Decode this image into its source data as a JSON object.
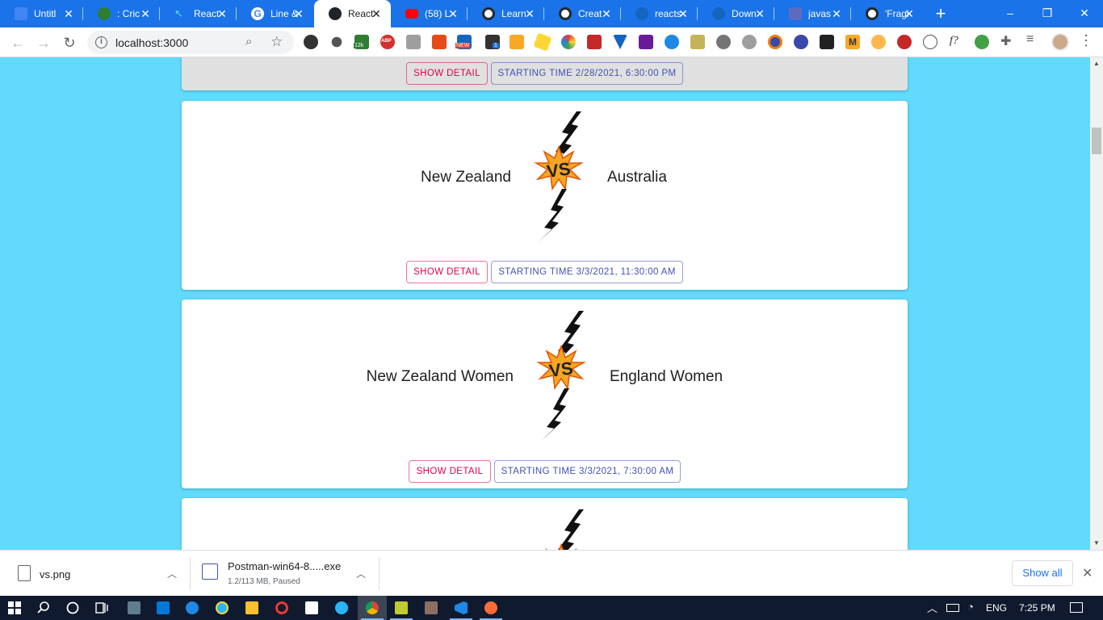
{
  "browser": {
    "tabs": [
      {
        "title": "Untitl",
        "favicon_color": "#4285f4",
        "active": false
      },
      {
        "title": ": Cric",
        "favicon_color": "#2e7d32",
        "active": false
      },
      {
        "title": "React",
        "favicon_color": "#61dafb",
        "active": false
      },
      {
        "title": "Line &",
        "favicon_color": "#ffffff",
        "active": false
      },
      {
        "title": "React",
        "favicon_color": "#20232a",
        "active": true
      },
      {
        "title": "(58) L",
        "favicon_color": "#ff0000",
        "active": false
      },
      {
        "title": "Learn",
        "favicon_color": "#24292e",
        "active": false
      },
      {
        "title": "Creat",
        "favicon_color": "#24292e",
        "active": false
      },
      {
        "title": "reacts",
        "favicon_color": "#1565c0",
        "active": false
      },
      {
        "title": "Down",
        "favicon_color": "#1565c0",
        "active": false
      },
      {
        "title": "javas",
        "favicon_color": "#5c6bc0",
        "active": false
      },
      {
        "title": "'Fragi",
        "favicon_color": "#24292e",
        "active": false
      }
    ],
    "new_tab": "+",
    "window_controls": {
      "minimize": "–",
      "restore": "❐",
      "close": "✕"
    },
    "nav": {
      "back": "←",
      "forward": "→",
      "reload": "↻"
    },
    "address": {
      "url": "localhost:3000",
      "info": "i",
      "zoom": "⌕",
      "star": "☆"
    },
    "extensions_badges": {
      "badge_12k": "12k",
      "badge_new": "NEW",
      "badge_1": "1",
      "badge_abp": "ABP",
      "badge_m": "M",
      "badge_f": "f?"
    },
    "menu": "⋮"
  },
  "page": {
    "partial_top_card": {
      "detail_label": "SHOW DETAIL",
      "time_label": "STARTING TIME 2/28/2021, 6:30:00 PM"
    },
    "matches": [
      {
        "team1": "New Zealand",
        "team2": "Australia",
        "detail_label": "SHOW DETAIL",
        "time_label": "STARTING TIME 3/3/2021, 11:30:00 AM"
      },
      {
        "team1": "New Zealand Women",
        "team2": "England Women",
        "detail_label": "SHOW DETAIL",
        "time_label": "STARTING TIME 3/3/2021, 7:30:00 AM"
      }
    ],
    "vs_text": "VS"
  },
  "downloads": {
    "items": [
      {
        "name": "vs.png",
        "status": ""
      },
      {
        "name": "Postman-win64-8.....exe",
        "status": "1.2/113 MB, Paused"
      }
    ],
    "show_all": "Show all",
    "close": "✕"
  },
  "taskbar": {
    "language": "ENG",
    "time": "7:25 PM"
  }
}
